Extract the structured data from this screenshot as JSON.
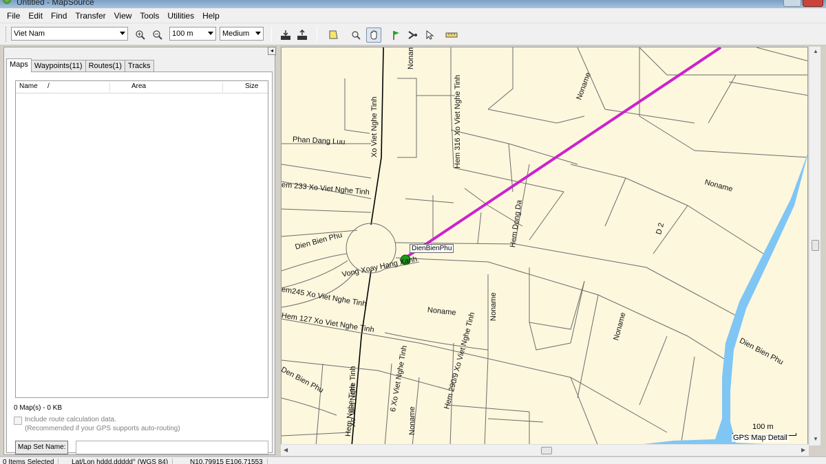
{
  "window": {
    "title": "Untitled - MapSource"
  },
  "menu": [
    "File",
    "Edit",
    "Find",
    "Transfer",
    "View",
    "Tools",
    "Utilities",
    "Help"
  ],
  "toolbar": {
    "region": "Viet Nam",
    "zoom_scale": "100 m",
    "detail_level": "Medium"
  },
  "panel": {
    "tabs": [
      "Maps",
      "Waypoints(11)",
      "Routes(1)",
      "Tracks"
    ],
    "columns": {
      "name": "Name",
      "sort": "/",
      "area": "Area",
      "size": "Size"
    },
    "summary": "0 Map(s) - 0 KB",
    "include_route_calc": "Include route calculation data.",
    "route_calc_note": "(Recommended if your GPS supports auto-routing)",
    "mapset_button": "Map Set Name:"
  },
  "map": {
    "waypoint_label": "DienBienPhu",
    "scale_label": "100 m",
    "detail_badge": "GPS Map Detail",
    "route_color": "#cc22cc",
    "water_color": "#7fc6f5",
    "street_labels": [
      "Noname",
      "Hem 316 Xo Viet Nghe Tinh",
      "Xo Viet Nghe Tinh",
      "Phan Dang Luu",
      "Noname",
      "em 233 Xo Viet Nghe Tinh",
      "Noname",
      "Hem Dong Da",
      "D 2",
      "Dien Bien Phu",
      "Vong Xoay Hang Xanh",
      "em245 Xo Viet Nghe Tinh",
      "Noname",
      "Noname",
      "Hem 127 Xo Viet Nghe Tinh",
      "Noname",
      "Dien Bien Phu",
      "Den Bien Phu",
      "Xo Viet Nghe Tinh",
      "Hem 290/9 Xo Viet Nghe Tinh",
      "6 Xo Viet Nghe Tinh",
      "Noname",
      "Hem Nghe Tinh"
    ]
  },
  "status": {
    "selected": "0 Items Selected",
    "format": "Lat/Lon hddd.ddddd° (WGS 84)",
    "coords": "N10.79915 E106.71553"
  }
}
